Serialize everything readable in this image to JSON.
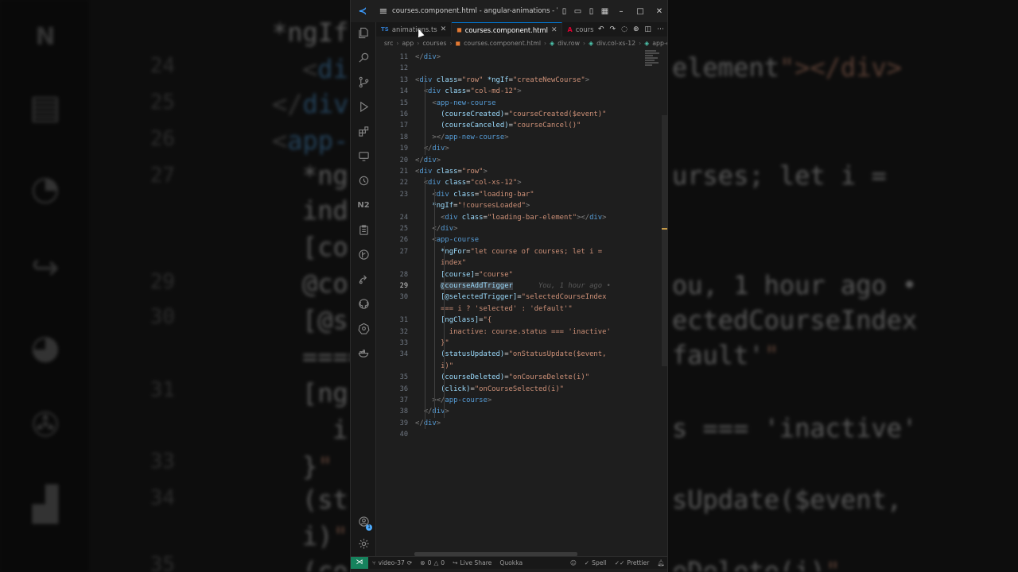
{
  "window": {
    "title": "courses.component.html - angular-animations - Vis..."
  },
  "tabs": [
    {
      "label": "animations.ts",
      "icon": "typescript-icon"
    },
    {
      "label": "courses.component.html",
      "icon": "html-icon"
    },
    {
      "label": "cours",
      "icon": "angular-icon"
    }
  ],
  "breadcrumbs": [
    "src",
    "app",
    "courses",
    "courses.component.html",
    "div.row",
    "div.col-xs-12",
    "app-co"
  ],
  "editor": {
    "current_line": 29,
    "blame_text": "You, 1 hour ago •",
    "lines": [
      {
        "n": "11",
        "text": "</div>"
      },
      {
        "n": "12",
        "text": ""
      },
      {
        "n": "13",
        "text": "<div class=\"row\" *ngIf=\"createNewCourse\">"
      },
      {
        "n": "14",
        "text": "  <div class=\"col-md-12\">"
      },
      {
        "n": "15",
        "text": "    <app-new-course"
      },
      {
        "n": "16",
        "text": "      (courseCreated)=\"courseCreated($event)\""
      },
      {
        "n": "17",
        "text": "      (courseCanceled)=\"courseCancel()\""
      },
      {
        "n": "18",
        "text": "    ></app-new-course>"
      },
      {
        "n": "19",
        "text": "  </div>"
      },
      {
        "n": "20",
        "text": "</div>"
      },
      {
        "n": "21",
        "text": "<div class=\"row\">"
      },
      {
        "n": "22",
        "text": "  <div class=\"col-xs-12\">"
      },
      {
        "n": "23",
        "text": "    <div class=\"loading-bar\""
      },
      {
        "n": "",
        "text": "    *ngIf=\"!coursesLoaded\">"
      },
      {
        "n": "24",
        "text": "      <div class=\"loading-bar-element\"></div>"
      },
      {
        "n": "25",
        "text": "    </div>"
      },
      {
        "n": "26",
        "text": "    <app-course"
      },
      {
        "n": "27",
        "text": "      *ngFor=\"let course of courses; let i ="
      },
      {
        "n": "",
        "text": "      index\""
      },
      {
        "n": "28",
        "text": "      [course]=\"course\""
      },
      {
        "n": "29",
        "text": "      @courseAddTrigger"
      },
      {
        "n": "30",
        "text": "      [@selectedTrigger]=\"selectedCourseIndex"
      },
      {
        "n": "",
        "text": "      === i ? 'selected' : 'default'\""
      },
      {
        "n": "31",
        "text": "      [ngClass]=\"{"
      },
      {
        "n": "32",
        "text": "        inactive: course.status === 'inactive'"
      },
      {
        "n": "33",
        "text": "      }\""
      },
      {
        "n": "34",
        "text": "      (statusUpdated)=\"onStatusUpdate($event,"
      },
      {
        "n": "",
        "text": "      i)\""
      },
      {
        "n": "35",
        "text": "      (courseDeleted)=\"onCourseDelete(i)\""
      },
      {
        "n": "36",
        "text": "      (click)=\"onCourseSelected(i)\""
      },
      {
        "n": "37",
        "text": "    ></app-course>"
      },
      {
        "n": "38",
        "text": "  </div>"
      },
      {
        "n": "39",
        "text": "</div>"
      },
      {
        "n": "40",
        "text": ""
      }
    ]
  },
  "status": {
    "branch": "video-37",
    "errors": "0",
    "warnings": "0",
    "live_share": "Live Share",
    "quokka": "Quokka",
    "spell": "Spell",
    "prettier": "Prettier"
  },
  "background": {
    "line_numbers": [
      "24",
      "25",
      "26",
      "27",
      "",
      "29",
      "30",
      "",
      "31",
      "",
      "33",
      "34",
      "",
      "35"
    ],
    "left_snippets": [
      "*ngIf",
      "<di",
      "</div",
      "<app-",
      "*ng",
      "ind",
      "[co",
      "@co",
      "[@s",
      "====",
      "[ng",
      "i",
      "}\"",
      "(st",
      "i)\"",
      "(co"
    ],
    "right_snippets": [
      "element\"></div>",
      "urses; let i =",
      "ou, 1 hour ago •",
      "ectedCourseIndex",
      "fault'\"",
      "s === 'inactive'",
      "sUpdate($event,",
      "eDelete(i)\""
    ]
  },
  "colors": {
    "accent": "#0078d4",
    "remote": "#16825d",
    "tag": "#569cd6",
    "attr": "#9cdcfe",
    "string": "#ce9178"
  }
}
